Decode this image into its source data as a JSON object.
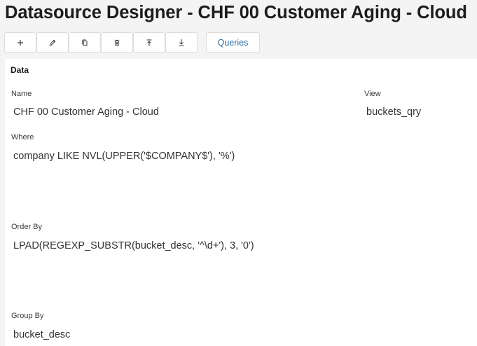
{
  "page": {
    "title": "Datasource Designer - CHF 00 Customer Aging - Cloud"
  },
  "toolbar": {
    "buttons": [
      {
        "name": "add-button",
        "icon": "plus-icon"
      },
      {
        "name": "edit-button",
        "icon": "pencil-icon"
      },
      {
        "name": "copy-button",
        "icon": "copy-icon"
      },
      {
        "name": "delete-button",
        "icon": "trash-icon"
      },
      {
        "name": "move-up-button",
        "icon": "arrow-up-icon"
      },
      {
        "name": "move-down-button",
        "icon": "arrow-down-icon"
      }
    ],
    "queries_label": "Queries"
  },
  "data_section": {
    "title": "Data",
    "name_label": "Name",
    "name_value": "CHF 00 Customer Aging - Cloud",
    "view_label": "View",
    "view_value": "buckets_qry",
    "where_label": "Where",
    "where_value": "company LIKE NVL(UPPER('$COMPANY$'), '%')",
    "order_by_label": "Order By",
    "order_by_value": "LPAD(REGEXP_SUBSTR(bucket_desc, '^\\d+'), 3, '0')",
    "group_by_label": "Group By",
    "group_by_value": "bucket_desc"
  },
  "colors": {
    "accent": "#2d6fa6",
    "background": "#f4f4f4",
    "panel": "#ffffff"
  }
}
